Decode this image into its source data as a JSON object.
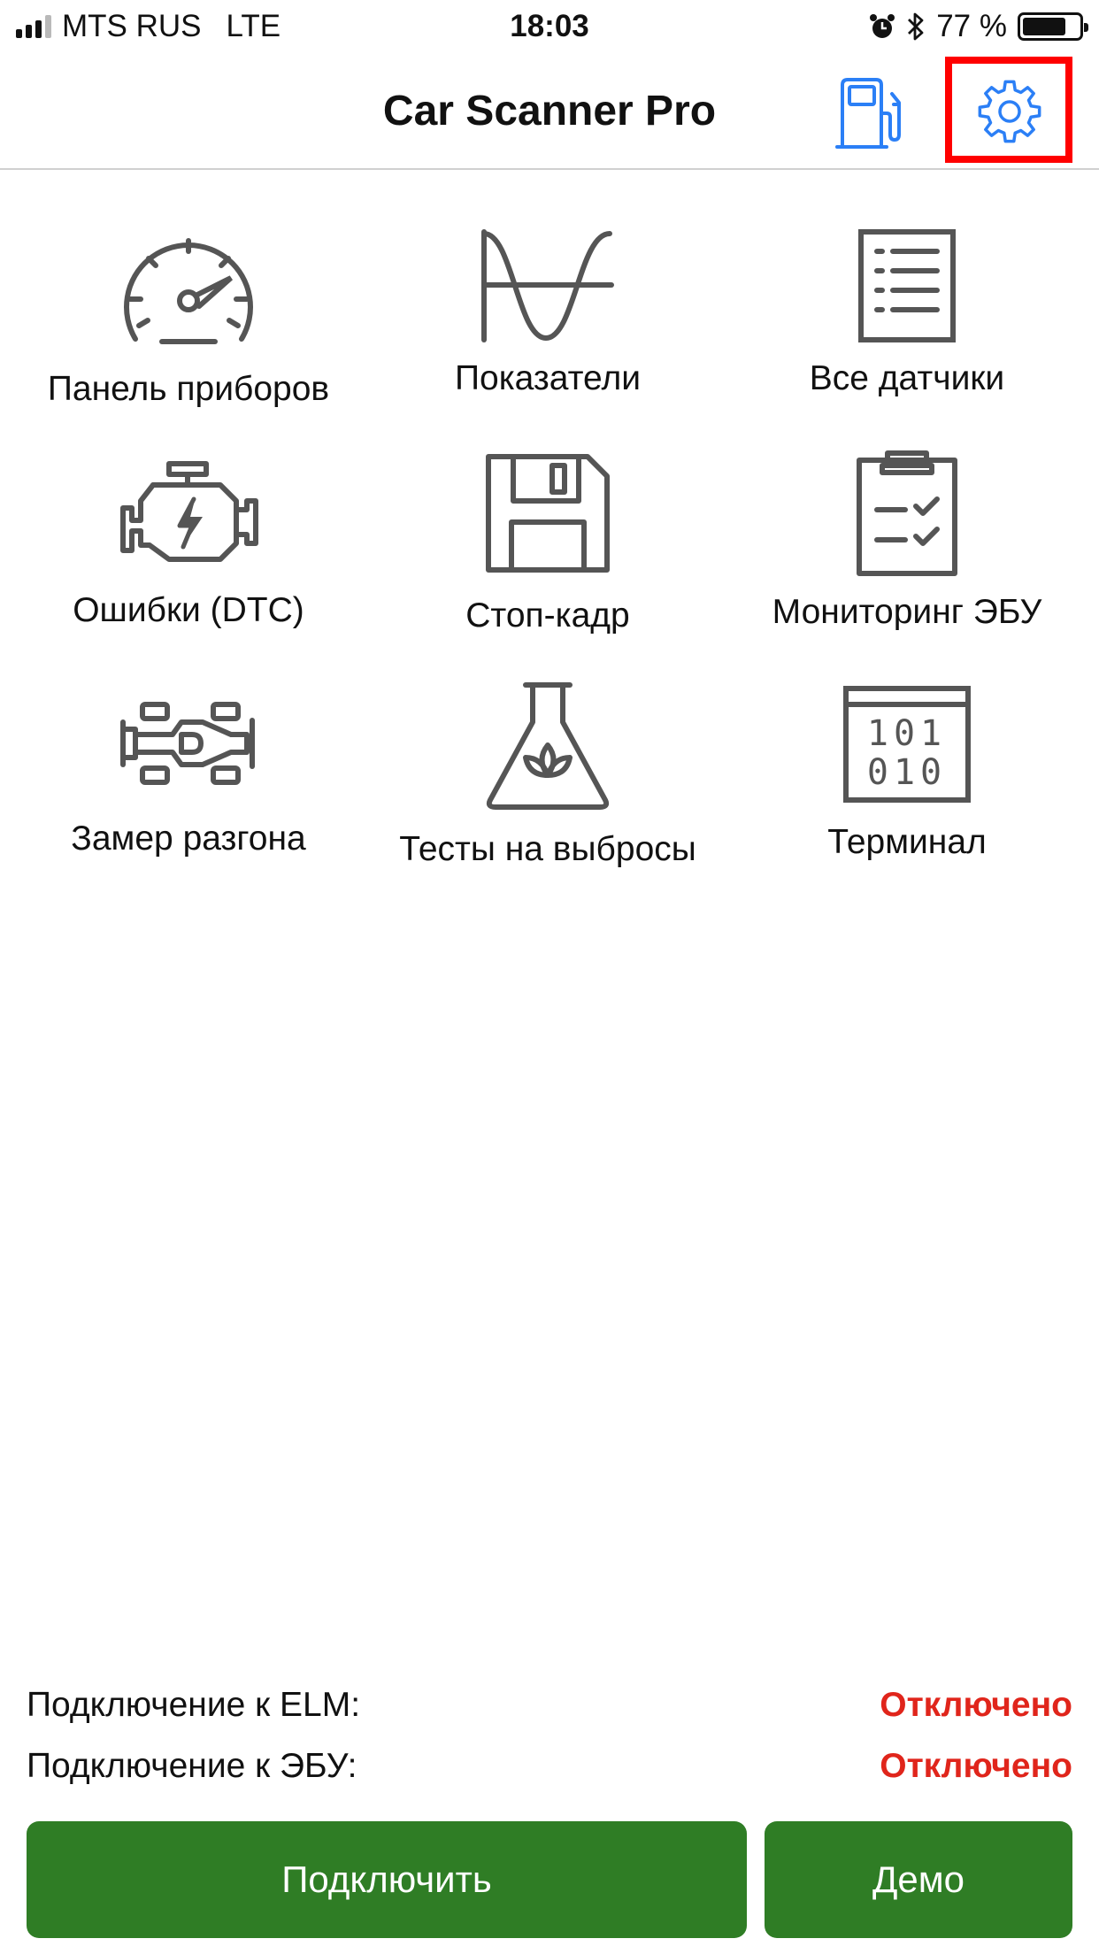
{
  "status_bar": {
    "carrier": "MTS RUS",
    "network": "LTE",
    "time": "18:03",
    "battery": "77 %",
    "battery_level": 0.77,
    "icons": [
      "alarm-icon",
      "bluetooth-icon"
    ]
  },
  "nav": {
    "title": "Car Scanner Pro",
    "fuel_icon": "fuel-pump-icon",
    "settings_icon": "gear-icon",
    "icon_color": "#2b7ff6",
    "highlight_color": "#ff0000"
  },
  "menu": [
    {
      "label": "Панель приборов",
      "icon": "speedometer-icon"
    },
    {
      "label": "Показатели",
      "icon": "sine-wave-icon"
    },
    {
      "label": "Все датчики",
      "icon": "list-document-icon"
    },
    {
      "label": "Ошибки (DTC)",
      "icon": "engine-icon"
    },
    {
      "label": "Стоп-кадр",
      "icon": "floppy-disk-icon"
    },
    {
      "label": "Мониторинг ЭБУ",
      "icon": "clipboard-check-icon"
    },
    {
      "label": "Замер разгона",
      "icon": "race-car-icon"
    },
    {
      "label": "Тесты на выбросы",
      "icon": "flask-leaf-icon"
    },
    {
      "label": "Терминал",
      "icon": "binary-terminal-icon",
      "code": [
        "101",
        "010"
      ]
    }
  ],
  "connection": {
    "elm_label": "Подключение к ELM:",
    "elm_status": "Отключено",
    "ecu_label": "Подключение к ЭБУ:",
    "ecu_status": "Отключено",
    "status_color": "#e0251b"
  },
  "buttons": {
    "connect": "Подключить",
    "demo": "Демо",
    "color": "#2f7d25"
  }
}
